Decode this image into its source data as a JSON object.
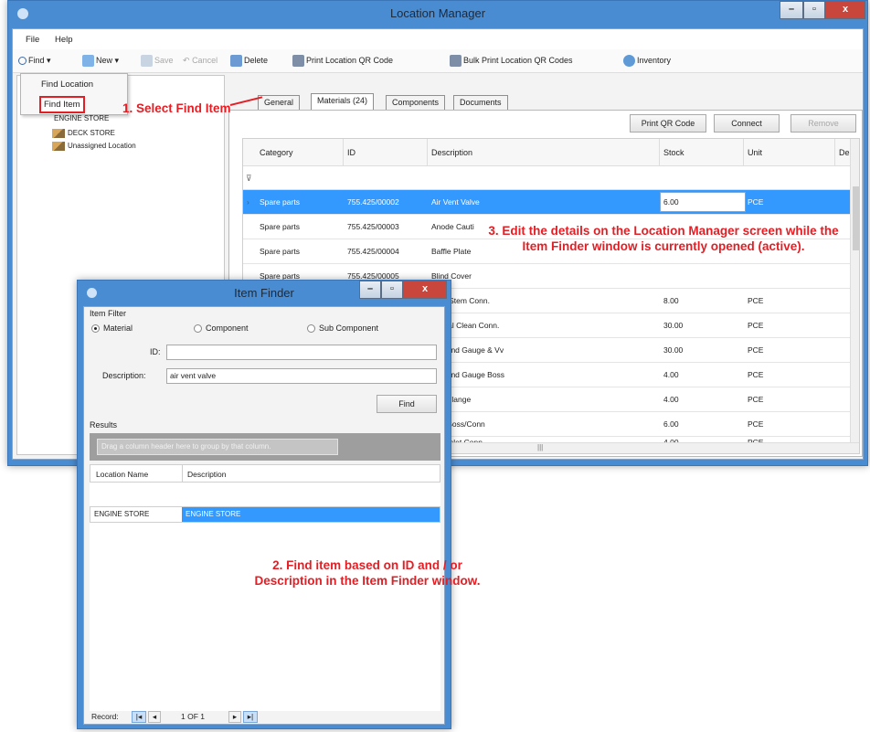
{
  "main_window": {
    "title": "Location Manager",
    "menu": [
      "File",
      "Help"
    ],
    "toolbar": {
      "find": "Find",
      "new": "New",
      "save": "Save",
      "cancel": "Cancel",
      "delete": "Delete",
      "print_qr": "Print Location QR Code",
      "bulk_print_qr": "Bulk Print Location QR Codes",
      "inventory": "Inventory"
    },
    "find_menu": [
      "Find Location",
      "Find Item"
    ],
    "tree": {
      "partial": "ENGINE STORE",
      "items": [
        "DECK STORE",
        "Unassigned Location"
      ]
    },
    "tabs": [
      "General",
      "Materials (24)",
      "Components",
      "Documents"
    ],
    "buttons": {
      "print_qr": "Print QR Code",
      "connect": "Connect",
      "remove": "Remove"
    },
    "grid": {
      "columns": [
        "Category",
        "ID",
        "Description",
        "Stock",
        "Unit",
        "De"
      ],
      "rows": [
        {
          "category": "Spare parts",
          "id": "755.425/00002",
          "description": "Air Vent Valve",
          "stock": "6.00",
          "unit": "PCE"
        },
        {
          "category": "Spare parts",
          "id": "755.425/00003",
          "description": "Anode Cauti",
          "stock": "",
          "unit": ""
        },
        {
          "category": "Spare parts",
          "id": "755.425/00004",
          "description": "Baffle Plate",
          "stock": "",
          "unit": ""
        },
        {
          "category": "Spare parts",
          "id": "755.425/00005",
          "description": "Blind Cover",
          "stock": "",
          "unit": ""
        },
        {
          "category": "",
          "id": "",
          "description": "g Stem Conn.",
          "stock": "8.00",
          "unit": "PCE"
        },
        {
          "category": "",
          "id": "",
          "description": "ical Clean Conn.",
          "stock": "30.00",
          "unit": "PCE"
        },
        {
          "category": "",
          "id": "",
          "description": "ound Gauge & Vv",
          "stock": "30.00",
          "unit": "PCE"
        },
        {
          "category": "",
          "id": "",
          "description": "ound Gauge Boss",
          "stock": "4.00",
          "unit": "PCE"
        },
        {
          "category": "",
          "id": "",
          "description": "r Flange",
          "stock": "4.00",
          "unit": "PCE"
        },
        {
          "category": "",
          "id": "",
          "description": "r Boss/Conn",
          "stock": "6.00",
          "unit": "PCE"
        },
        {
          "category": "",
          "id": "",
          "description": "r Inlet Conn.",
          "stock": "4.00",
          "unit": "PCE"
        }
      ]
    }
  },
  "item_finder": {
    "title": "Item Finder",
    "filter_label": "Item Filter",
    "radios": [
      "Material",
      "Component",
      "Sub Component"
    ],
    "id_label": "ID:",
    "id_value": "",
    "desc_label": "Description:",
    "desc_value": "air vent valve",
    "find_button": "Find",
    "results_label": "Results",
    "group_hint": "Drag a column header here to group by that column.",
    "columns": [
      "Location Name",
      "Description"
    ],
    "result": {
      "location": "ENGINE STORE",
      "description": "ENGINE STORE"
    },
    "nav": {
      "record_label": "Record:",
      "page": "1 OF 1"
    }
  },
  "annotations": {
    "step1": "1. Select Find Item",
    "step2": "2. Find item based on ID and / or Description in the Item Finder window.",
    "step3": "3. Edit the details on the Location Manager screen while the Item Finder window is currently opened (active)."
  },
  "colors": {
    "title_bar": "#4a8cd1",
    "selection": "#3399ff",
    "annotation": "#e31e24",
    "close_button": "#c9463d"
  }
}
